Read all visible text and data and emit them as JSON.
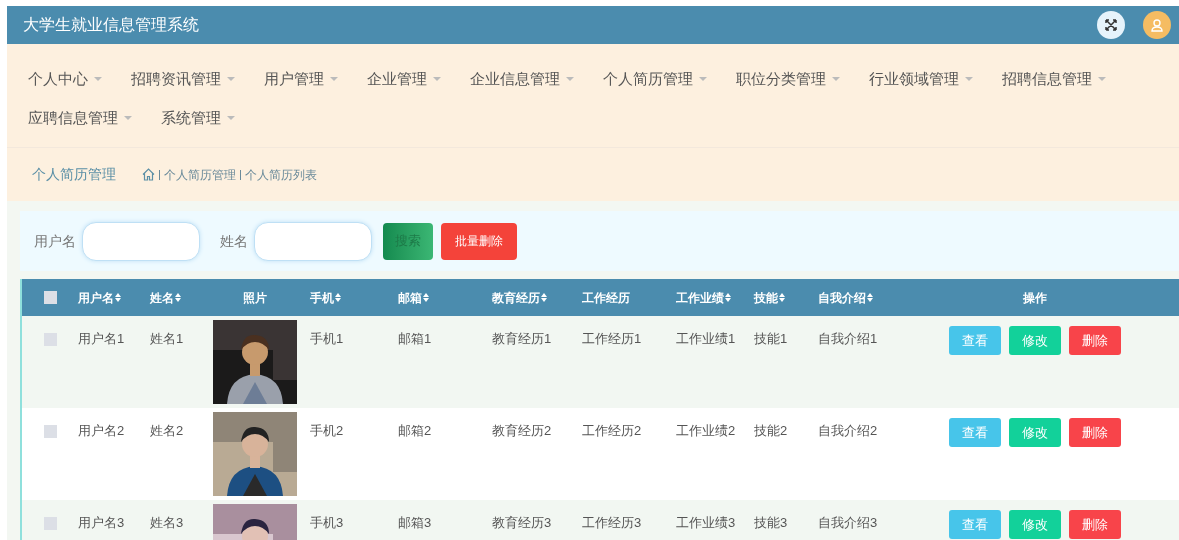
{
  "header": {
    "title": "大学生就业信息管理系统"
  },
  "nav": [
    {
      "label": "个人中心"
    },
    {
      "label": "招聘资讯管理"
    },
    {
      "label": "用户管理"
    },
    {
      "label": "企业管理"
    },
    {
      "label": "企业信息管理"
    },
    {
      "label": "个人简历管理"
    },
    {
      "label": "职位分类管理"
    },
    {
      "label": "行业领域管理"
    },
    {
      "label": "招聘信息管理"
    },
    {
      "label": "应聘信息管理"
    },
    {
      "label": "系统管理"
    }
  ],
  "breadcrumb": {
    "title": "个人简历管理",
    "path": [
      "个人简历管理",
      "个人简历列表"
    ]
  },
  "search": {
    "fields": [
      {
        "label": "用户名"
      },
      {
        "label": "姓名"
      }
    ],
    "search_button": "搜索",
    "batch_delete_button": "批量删除"
  },
  "table": {
    "select_all_checked": false,
    "columns": [
      {
        "label": "用户名",
        "sortable": true
      },
      {
        "label": "姓名",
        "sortable": true
      },
      {
        "label": "照片",
        "sortable": false,
        "kind": "picture"
      },
      {
        "label": "手机",
        "sortable": true
      },
      {
        "label": "邮箱",
        "sortable": true
      },
      {
        "label": "教育经历",
        "sortable": true
      },
      {
        "label": "工作经历",
        "sortable": false
      },
      {
        "label": "工作业绩",
        "sortable": true
      },
      {
        "label": "技能",
        "sortable": true
      },
      {
        "label": "自我介绍",
        "sortable": true
      },
      {
        "label": "操作",
        "sortable": false
      }
    ],
    "rows": [
      {
        "checked": false,
        "cells": [
          "用户名1",
          "姓名1",
          "",
          "手机1",
          "邮箱1",
          "教育经历1",
          "工作经历1",
          "工作业绩1",
          "技能1",
          "自我介绍1"
        ],
        "actions": [
          "查看",
          "修改",
          "删除"
        ]
      },
      {
        "checked": false,
        "cells": [
          "用户名2",
          "姓名2",
          "",
          "手机2",
          "邮箱2",
          "教育经历2",
          "工作经历2",
          "工作业绩2",
          "技能2",
          "自我介绍2"
        ],
        "actions": [
          "查看",
          "修改",
          "删除"
        ]
      },
      {
        "checked": false,
        "cells": [
          "用户名3",
          "姓名3",
          "",
          "手机3",
          "邮箱3",
          "教育经历3",
          "工作经历3",
          "工作业绩3",
          "技能3",
          "自我介绍3"
        ],
        "actions": [
          "查看",
          "修改",
          "删除"
        ]
      }
    ]
  }
}
